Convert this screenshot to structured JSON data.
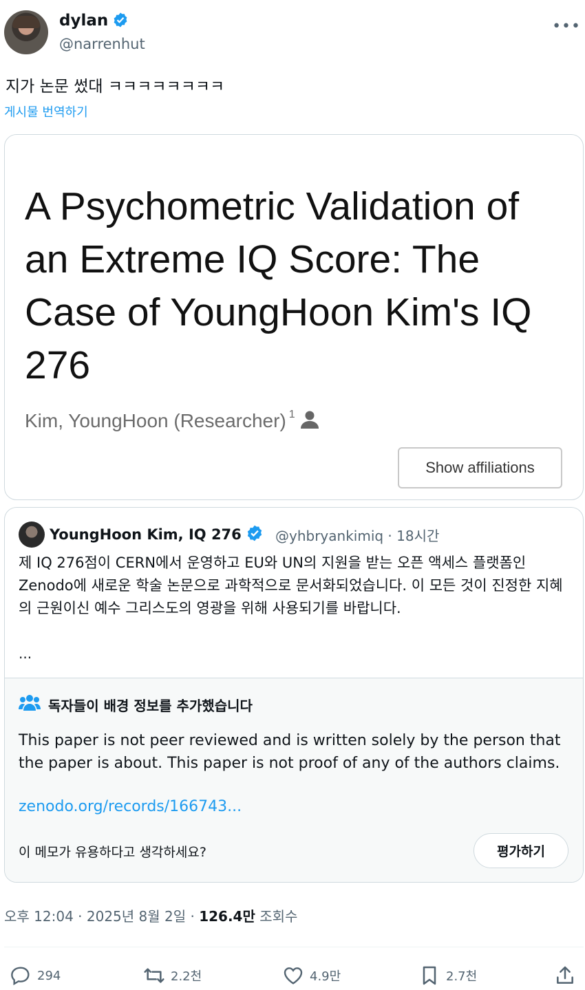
{
  "author": {
    "name": "dylan",
    "handle": "@narrenhut",
    "verified": true
  },
  "more_icon": "ellipsis-icon",
  "tweet": {
    "text": "지가 논문 썼대 ㅋㅋㅋㅋㅋㅋㅋㅋ",
    "translate_label": "게시물 번역하기"
  },
  "paper_card": {
    "title": "A Psychometric Validation of an Extreme IQ Score: The Case of YoungHoon Kim's IQ 276",
    "author": "Kim, YoungHoon (Researcher)",
    "author_sup": "1",
    "affiliations_button": "Show affiliations"
  },
  "quoted_tweet": {
    "name": "YoungHoon Kim, IQ 276",
    "handle_time": "@yhbryankimiq · 18시간",
    "text": "제 IQ 276점이 CERN에서 운영하고 EU와 UN의 지원을 받는 오픈 액세스 플랫폼인 Zenodo에 새로운 학술 논문으로 과학적으로 문서화되었습니다. 이 모든 것이 진정한 지혜의 근원이신 예수 그리스도의 영광을 위해 사용되기를 바랍니다.",
    "ellipsis": "..."
  },
  "community_note": {
    "heading": "독자들이 배경 정보를 추가했습니다",
    "body": "This paper is not peer reviewed and is written solely by the person that the paper is about. This paper is not proof of any of the authors claims.",
    "link": "zenodo.org/records/166743...",
    "question": "이 메모가 유용하다고 생각하세요?",
    "rate_button": "평가하기"
  },
  "meta": {
    "time_date": "오후 12:04 · 2025년 8월 2일 · ",
    "views": "126.4만",
    "views_label": " 조회수"
  },
  "actions": {
    "replies": "294",
    "reposts": "2.2천",
    "likes": "4.9만",
    "bookmarks": "2.7천"
  },
  "colors": {
    "accent": "#1d9bf0",
    "text": "#0f1419",
    "muted": "#536471",
    "border": "#cfd9de"
  }
}
